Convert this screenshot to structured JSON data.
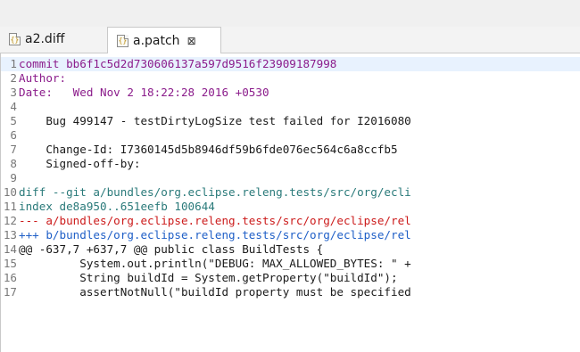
{
  "tabs": [
    {
      "label": "a2.diff",
      "icon": "diff-file-icon",
      "active": false
    },
    {
      "label": "a.patch",
      "icon": "patch-file-icon",
      "active": true,
      "close": "⊠"
    }
  ],
  "lines": [
    {
      "n": "1",
      "t": "commit bb6f1c5d2d730606137a597d9516f23909187998",
      "s": "meta"
    },
    {
      "n": "2",
      "t": "Author:",
      "s": "meta"
    },
    {
      "n": "3",
      "t": "Date:   Wed Nov 2 18:22:28 2016 +0530",
      "s": "meta"
    },
    {
      "n": "4",
      "t": "",
      "s": "plain"
    },
    {
      "n": "5",
      "t": "    Bug 499147 - testDirtyLogSize test failed for I2016080",
      "s": "plain"
    },
    {
      "n": "6",
      "t": "",
      "s": "plain"
    },
    {
      "n": "7",
      "t": "    Change-Id: I7360145d5b8946df59b6fde076ec564c6a8ccfb5",
      "s": "plain"
    },
    {
      "n": "8",
      "t": "    Signed-off-by:",
      "s": "plain"
    },
    {
      "n": "9",
      "t": "",
      "s": "plain"
    },
    {
      "n": "10",
      "t": "diff --git a/bundles/org.eclipse.releng.tests/src/org/ecli",
      "s": "diff"
    },
    {
      "n": "11",
      "t": "index de8a950..651eefb 100644",
      "s": "diff"
    },
    {
      "n": "12",
      "t": "--- a/bundles/org.eclipse.releng.tests/src/org/eclipse/rel",
      "s": "del"
    },
    {
      "n": "13",
      "t": "+++ b/bundles/org.eclipse.releng.tests/src/org/eclipse/rel",
      "s": "add"
    },
    {
      "n": "14",
      "t": "@@ -637,7 +637,7 @@ public class BuildTests {",
      "s": "hunk"
    },
    {
      "n": "15",
      "t": "         System.out.println(\"DEBUG: MAX_ALLOWED_BYTES: \" +",
      "s": "plain"
    },
    {
      "n": "16",
      "t": "         String buildId = System.getProperty(\"buildId\");",
      "s": "plain"
    },
    {
      "n": "17",
      "t": "         assertNotNull(\"buildId property must be specified",
      "s": "plain"
    }
  ]
}
